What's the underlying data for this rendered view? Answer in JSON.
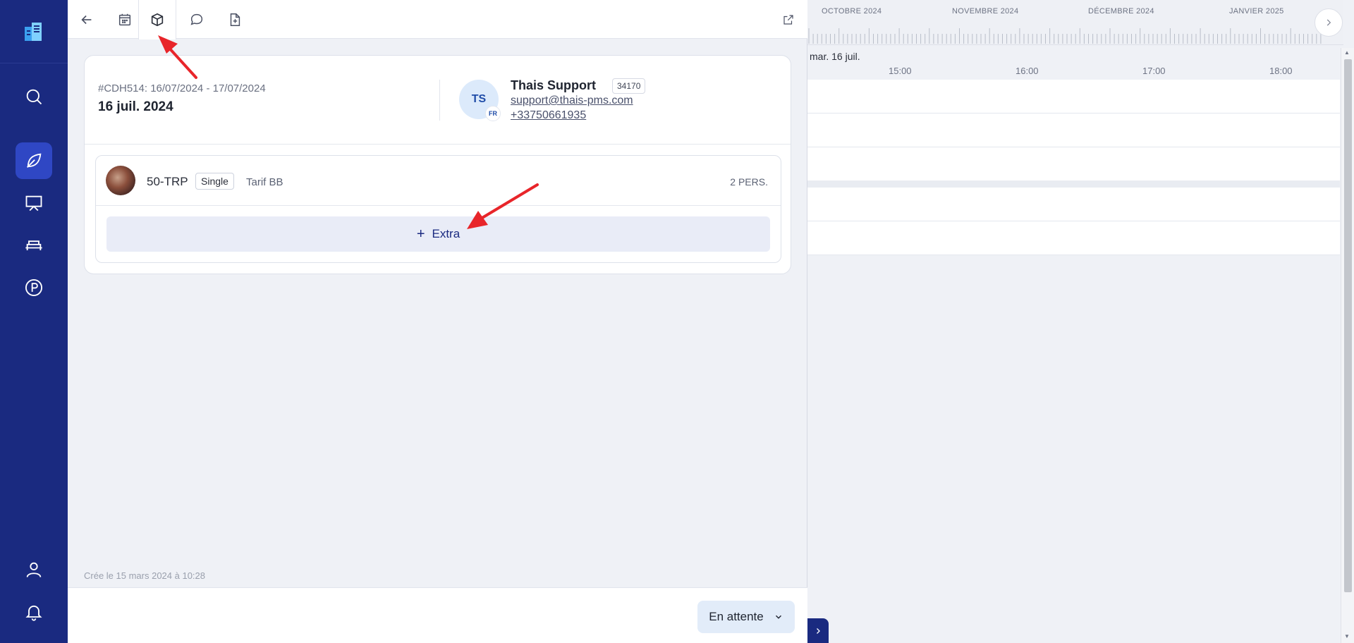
{
  "sidebar": {
    "items": [
      {
        "name": "search-icon"
      },
      {
        "name": "leaf-icon",
        "active": true
      },
      {
        "name": "presentation-icon"
      },
      {
        "name": "bed-icon"
      },
      {
        "name": "parking-icon"
      },
      {
        "name": "user-icon"
      },
      {
        "name": "bell-icon"
      }
    ]
  },
  "toolbar": {
    "buttons": [
      "back-arrow-icon",
      "calendar-icon",
      "box-icon",
      "chat-icon",
      "file-add-icon"
    ],
    "active": "box-icon",
    "external": "external-link-icon"
  },
  "reservation": {
    "ref": "#CDH514: 16/07/2024 - 17/07/2024",
    "date": "16 juil. 2024"
  },
  "guest": {
    "initials": "TS",
    "flag": "FR",
    "name": "Thais Support",
    "id": "34170",
    "email": "support@thais-pms.com",
    "phone": "+33750661935"
  },
  "room": {
    "code": "50-TRP",
    "type": "Single",
    "tarif": "Tarif BB",
    "persons": "2 PERS."
  },
  "extra": {
    "plus": "+",
    "label": "Extra"
  },
  "created": "Crée le 15 mars 2024 à 10:28",
  "status": {
    "label": "En attente"
  },
  "timeline": {
    "months": [
      "OCTOBRE 2024",
      "NOVEMBRE 2024",
      "DÉCEMBRE 2024",
      "JANVIER 2025"
    ],
    "day": "mar. 16 juil.",
    "hours": [
      "15:00",
      "16:00",
      "17:00",
      "18:00"
    ]
  },
  "colors": {
    "sidebar": "#1a2a80",
    "accent": "#2f47c4",
    "annotation": "#e8252a"
  }
}
